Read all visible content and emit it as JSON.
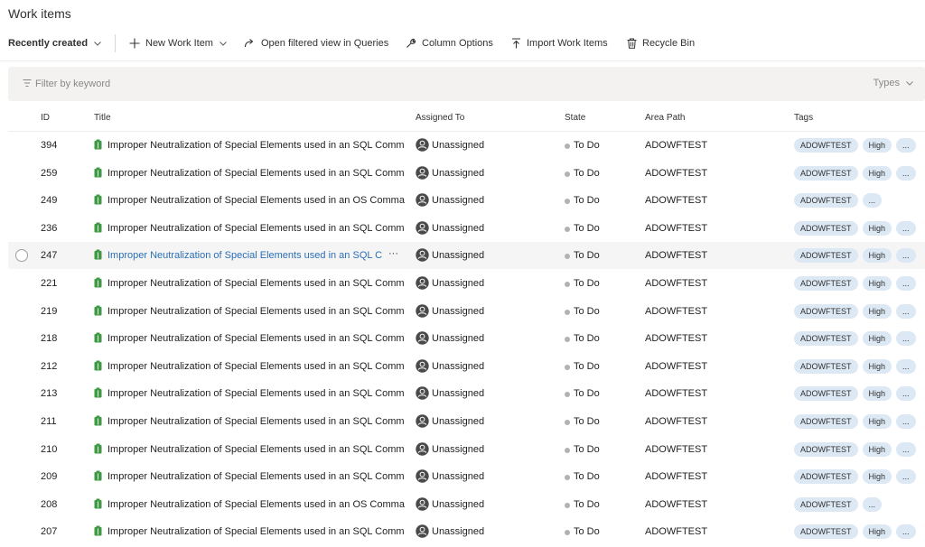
{
  "page": {
    "title": "Work items"
  },
  "toolbar": {
    "recently_created": "Recently created",
    "new_work_item": "New Work Item",
    "open_filtered_view": "Open filtered view in Queries",
    "column_options": "Column Options",
    "import_work_items": "Import Work Items",
    "recycle_bin": "Recycle Bin"
  },
  "filter": {
    "placeholder": "Filter by keyword",
    "types_label": "Types"
  },
  "columns": {
    "id": "ID",
    "title": "Title",
    "assigned_to": "Assigned To",
    "state": "State",
    "area_path": "Area Path",
    "tags": "Tags"
  },
  "colors": {
    "accent": "#2b6fb5",
    "tag_bg": "#dce8f4",
    "bug_icon": "#3f9b43",
    "state_todo": "#b2b2b2"
  },
  "icons": {
    "type": "green-work-item-icon",
    "assigned": "unassigned-avatar-icon",
    "new": "plus-icon",
    "open": "redo-arrow-icon",
    "columns": "wrench-icon",
    "import": "upload-icon",
    "recycle": "trash-icon",
    "filter": "filter-icon"
  },
  "rows": [
    {
      "id": "394",
      "title": "Improper Neutralization of Special Elements used in an SQL Comm",
      "assigned": "Unassigned",
      "state": "To Do",
      "area": "ADOWFTEST",
      "tags": [
        "ADOWFTEST",
        "High",
        "..."
      ]
    },
    {
      "id": "259",
      "title": "Improper Neutralization of Special Elements used in an SQL Comm",
      "assigned": "Unassigned",
      "state": "To Do",
      "area": "ADOWFTEST",
      "tags": [
        "ADOWFTEST",
        "High",
        "..."
      ]
    },
    {
      "id": "249",
      "title": "Improper Neutralization of Special Elements used in an OS Comma",
      "assigned": "Unassigned",
      "state": "To Do",
      "area": "ADOWFTEST",
      "tags": [
        "ADOWFTEST",
        "..."
      ]
    },
    {
      "id": "236",
      "title": "Improper Neutralization of Special Elements used in an SQL Comm",
      "assigned": "Unassigned",
      "state": "To Do",
      "area": "ADOWFTEST",
      "tags": [
        "ADOWFTEST",
        "High",
        "..."
      ]
    },
    {
      "id": "247",
      "title": "Improper Neutralization of Special Elements used in an SQL C",
      "more": "···",
      "assigned": "Unassigned",
      "state": "To Do",
      "area": "ADOWFTEST",
      "tags": [
        "ADOWFTEST",
        "High",
        "..."
      ]
    },
    {
      "id": "221",
      "title": "Improper Neutralization of Special Elements used in an SQL Comm",
      "assigned": "Unassigned",
      "state": "To Do",
      "area": "ADOWFTEST",
      "tags": [
        "ADOWFTEST",
        "High",
        "..."
      ]
    },
    {
      "id": "219",
      "title": "Improper Neutralization of Special Elements used in an SQL Comm",
      "assigned": "Unassigned",
      "state": "To Do",
      "area": "ADOWFTEST",
      "tags": [
        "ADOWFTEST",
        "High",
        "..."
      ]
    },
    {
      "id": "218",
      "title": "Improper Neutralization of Special Elements used in an SQL Comm",
      "assigned": "Unassigned",
      "state": "To Do",
      "area": "ADOWFTEST",
      "tags": [
        "ADOWFTEST",
        "High",
        "..."
      ]
    },
    {
      "id": "212",
      "title": "Improper Neutralization of Special Elements used in an SQL Comm",
      "assigned": "Unassigned",
      "state": "To Do",
      "area": "ADOWFTEST",
      "tags": [
        "ADOWFTEST",
        "High",
        "..."
      ]
    },
    {
      "id": "213",
      "title": "Improper Neutralization of Special Elements used in an SQL Comm",
      "assigned": "Unassigned",
      "state": "To Do",
      "area": "ADOWFTEST",
      "tags": [
        "ADOWFTEST",
        "High",
        "..."
      ]
    },
    {
      "id": "211",
      "title": "Improper Neutralization of Special Elements used in an SQL Comm",
      "assigned": "Unassigned",
      "state": "To Do",
      "area": "ADOWFTEST",
      "tags": [
        "ADOWFTEST",
        "High",
        "..."
      ]
    },
    {
      "id": "210",
      "title": "Improper Neutralization of Special Elements used in an SQL Comm",
      "assigned": "Unassigned",
      "state": "To Do",
      "area": "ADOWFTEST",
      "tags": [
        "ADOWFTEST",
        "High",
        "..."
      ]
    },
    {
      "id": "209",
      "title": "Improper Neutralization of Special Elements used in an SQL Comm",
      "assigned": "Unassigned",
      "state": "To Do",
      "area": "ADOWFTEST",
      "tags": [
        "ADOWFTEST",
        "High",
        "..."
      ]
    },
    {
      "id": "208",
      "title": "Improper Neutralization of Special Elements used in an OS Comma",
      "assigned": "Unassigned",
      "state": "To Do",
      "area": "ADOWFTEST",
      "tags": [
        "ADOWFTEST",
        "..."
      ]
    },
    {
      "id": "207",
      "title": "Improper Neutralization of Special Elements used in an SQL Comm",
      "assigned": "Unassigned",
      "state": "To Do",
      "area": "ADOWFTEST",
      "tags": [
        "ADOWFTEST",
        "High",
        "..."
      ]
    }
  ]
}
